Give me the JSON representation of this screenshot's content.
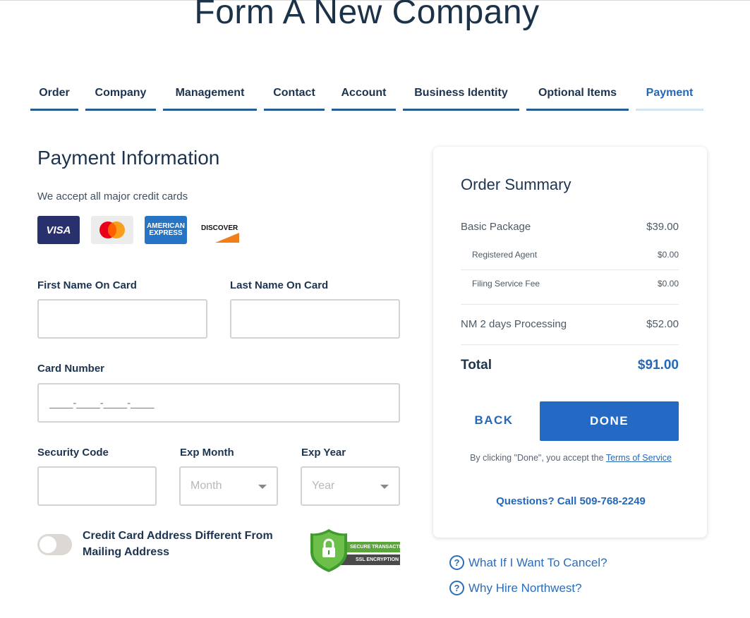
{
  "page_title": "Form A New Company",
  "steps": [
    {
      "label": "Order"
    },
    {
      "label": "Company"
    },
    {
      "label": "Management"
    },
    {
      "label": "Contact"
    },
    {
      "label": "Account"
    },
    {
      "label": "Business Identity"
    },
    {
      "label": "Optional Items"
    },
    {
      "label": "Payment",
      "current": true
    }
  ],
  "payment": {
    "title": "Payment Information",
    "accept_text": "We accept all major credit cards",
    "cards": {
      "visa": "VISA",
      "mastercard": "mastercard-logo",
      "amex_line1": "AMERICAN",
      "amex_line2": "EXPRESS",
      "discover": "DISCOVER"
    },
    "first_name_label": "First Name On Card",
    "last_name_label": "Last Name On Card",
    "card_number_label": "Card Number",
    "card_number_placeholder": "____-____-____-____",
    "security_code_label": "Security Code",
    "exp_month_label": "Exp Month",
    "exp_month_value": "Month",
    "exp_year_label": "Exp Year",
    "exp_year_value": "Year",
    "toggle_label": "Credit Card Address Different From Mailing Address",
    "ssl_line1": "SECURE TRANSACTION",
    "ssl_line2": "SSL ENCRYPTION"
  },
  "summary": {
    "title": "Order Summary",
    "items": [
      {
        "label": "Basic Package",
        "amount": "$39.00"
      },
      {
        "label": "Registered Agent",
        "amount": "$0.00"
      },
      {
        "label": "Filing Service Fee",
        "amount": "$0.00"
      },
      {
        "label": "NM 2 days Processing",
        "amount": "$52.00"
      }
    ],
    "total_label": "Total",
    "total_amount": "$91.00",
    "back_label": "BACK",
    "done_label": "DONE",
    "terms_prefix": "By clicking \"Done\", you accept the",
    "terms_link": "Terms of Service",
    "phone_text": "Questions? Call 509-768-2249"
  },
  "faq": [
    {
      "label": "What If I Want To Cancel?"
    },
    {
      "label": "Why Hire Northwest?"
    }
  ],
  "colors": {
    "accent": "#2469c4",
    "navy": "#1d3450",
    "field_border": "#d6d3cf"
  },
  "icons": [
    "question-circle-icon",
    "lock-shield-icon",
    "caret-down-icon"
  ]
}
